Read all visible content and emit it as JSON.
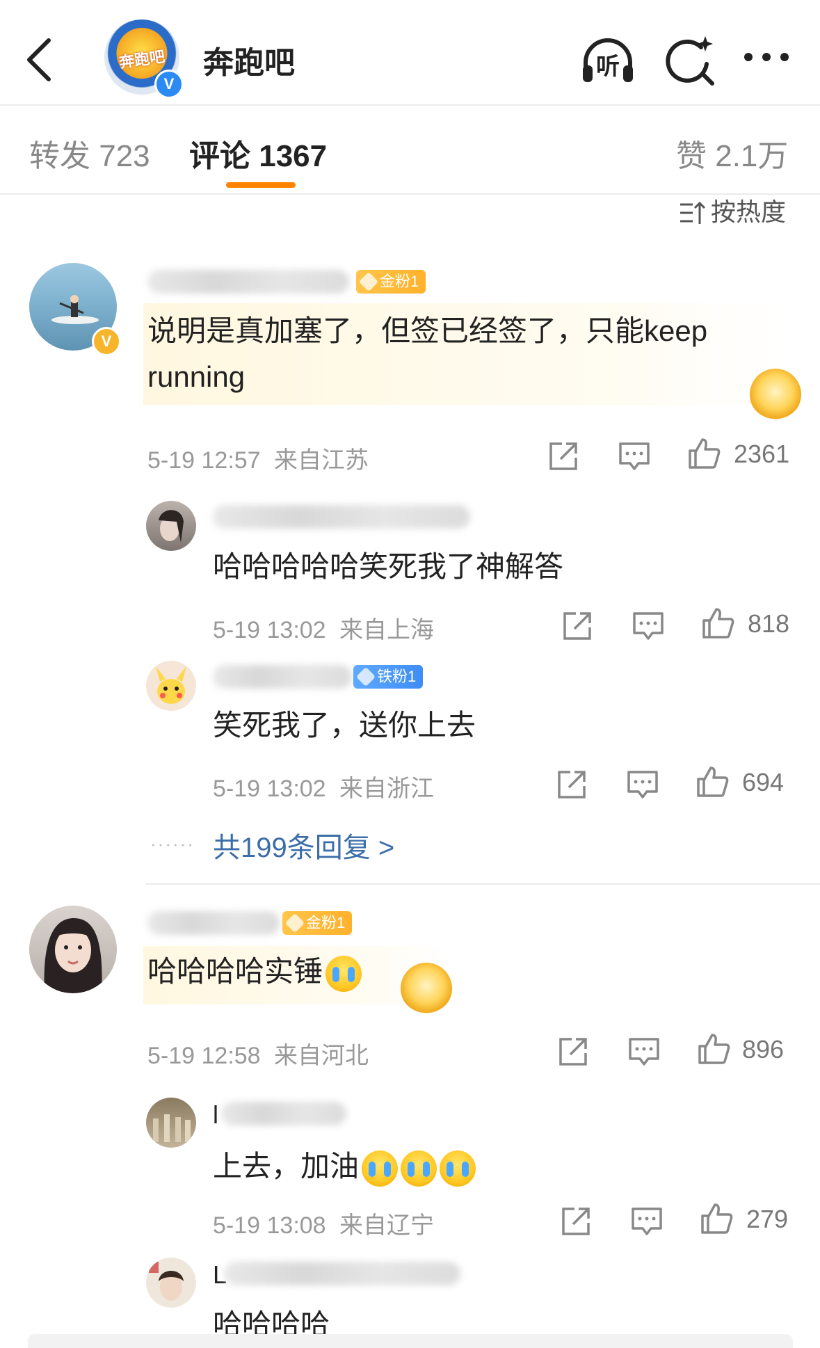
{
  "header": {
    "title": "奔跑吧",
    "logo_text": "奔跑吧",
    "listen_label": "听"
  },
  "tabs": [
    {
      "label": "转发",
      "count": "723"
    },
    {
      "label": "评论",
      "count": "1367"
    },
    {
      "label": "赞",
      "count": "2.1万"
    }
  ],
  "sort_label": "按热度",
  "accent_color": "#ff8200",
  "comments": [
    {
      "badge": "金粉1",
      "text_line1": "说明是真加塞了，但签已经签了，只能keep",
      "text_line2": "running",
      "time": "5-19 12:57",
      "location": "来自江苏",
      "likes": "2361",
      "replies": [
        {
          "text": "哈哈哈哈哈笑死我了神解答",
          "time": "5-19 13:02",
          "location": "来自上海",
          "likes": "818"
        },
        {
          "badge": "铁粉1",
          "text": "笑死我了，送你上去",
          "time": "5-19 13:02",
          "location": "来自浙江",
          "likes": "694"
        }
      ],
      "more_replies": "共199条回复 >"
    },
    {
      "badge": "金粉1",
      "text": "哈哈哈哈实锤",
      "time": "5-19 12:58",
      "location": "来自河北",
      "likes": "896",
      "replies": [
        {
          "name_initial": "l",
          "text": "上去，加油",
          "time": "5-19 13:08",
          "location": "来自辽宁",
          "likes": "279"
        },
        {
          "name_initial": "L",
          "text": "哈哈哈哈"
        }
      ]
    }
  ]
}
